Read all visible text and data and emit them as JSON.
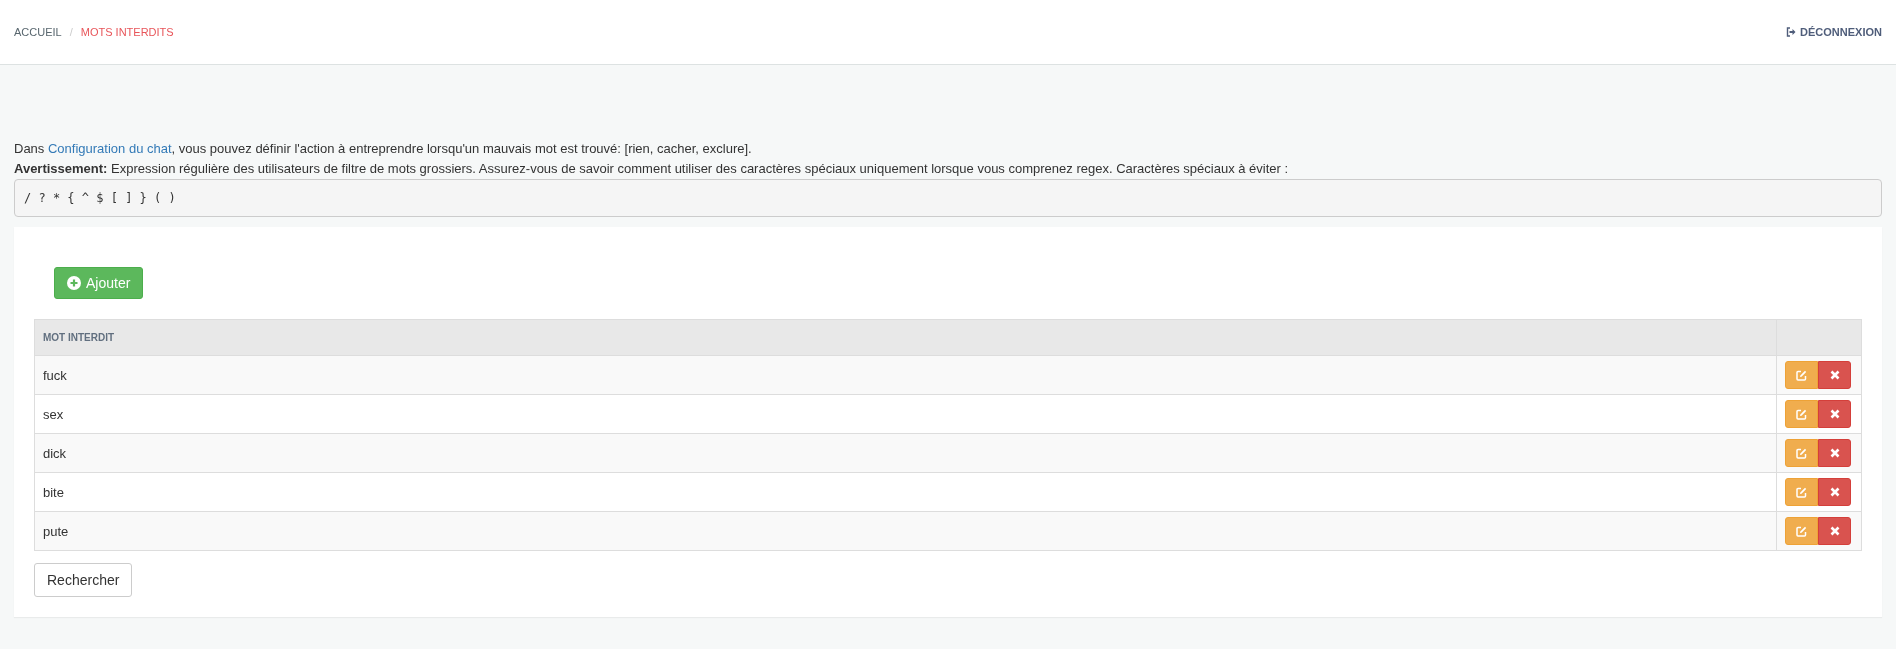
{
  "breadcrumb": [
    {
      "label": "ACCUEIL",
      "selected": false
    },
    {
      "label": "MOTS INTERDITS",
      "selected": true
    }
  ],
  "breadcrumb_separator": "/",
  "logout": {
    "label": "DÉCONNEXION"
  },
  "intro": {
    "before": "Dans ",
    "link": "Configuration du chat",
    "after": ", vous pouvez définir l'action à entreprendre lorsqu'un mauvais mot est trouvé: [rien, cacher, exclure]."
  },
  "warning": "**Avertissement:** Expression régulière des utilisateurs de filtre de mots grossiers. Assurez-vous de savoir comment utiliser des caractères spéciaux uniquement lorsque vous comprenez regex. Caractères spéciaux à éviter :",
  "special_chars": "/ ? * { ^ $ [ ] } ( )",
  "add_button": "Ajouter",
  "table": {
    "columns": [
      "MOT INTERDIT"
    ],
    "rows": [
      {
        "word": "fuck"
      },
      {
        "word": "sex"
      },
      {
        "word": "dick"
      },
      {
        "word": "bite"
      },
      {
        "word": "pute"
      }
    ]
  },
  "search_button": "Rechercher"
}
